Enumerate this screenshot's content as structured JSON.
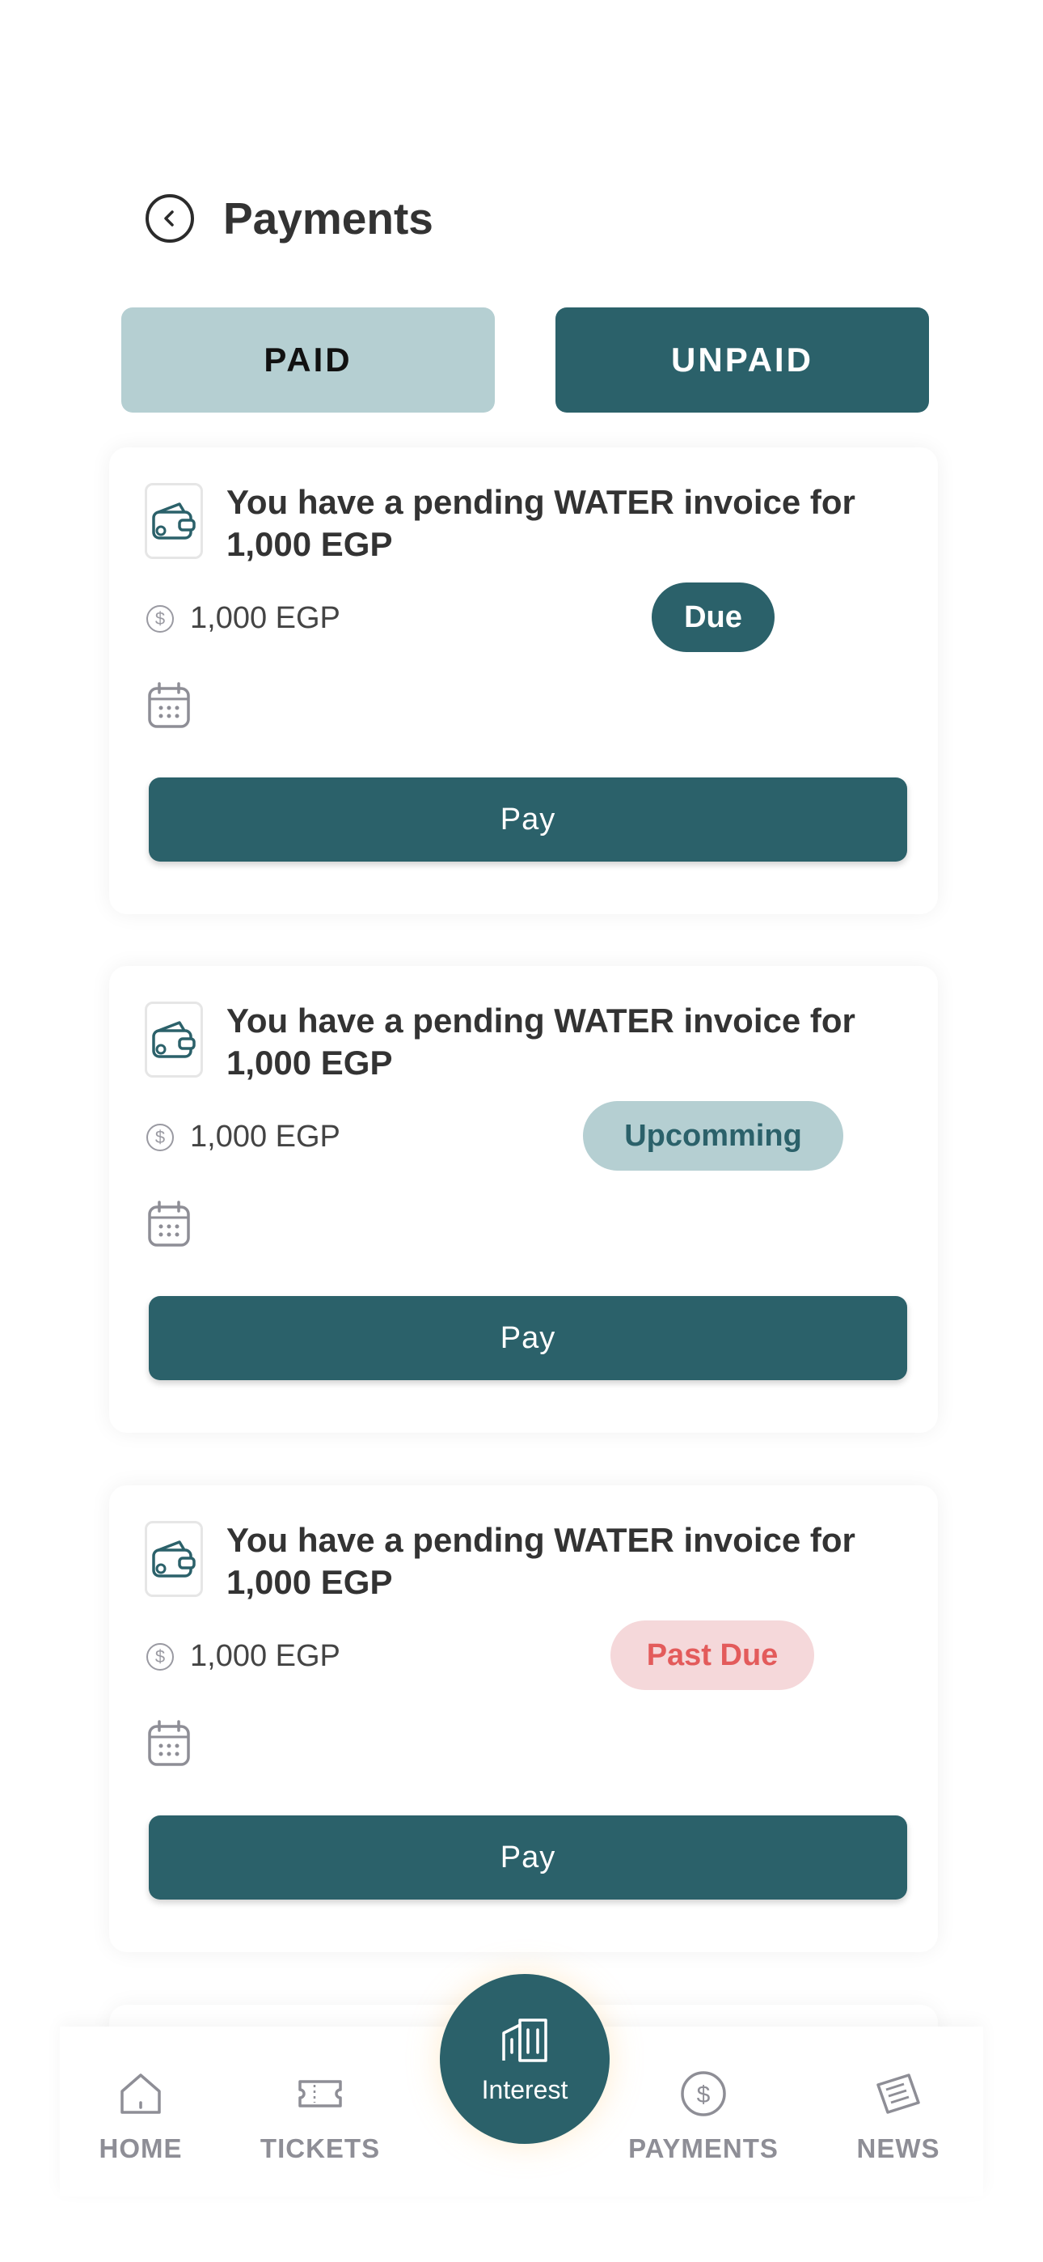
{
  "header": {
    "title": "Payments"
  },
  "tabs": {
    "paid": "PAID",
    "unpaid": "UNPAID"
  },
  "cards": [
    {
      "title": "You have a pending WATER invoice for 1,000 EGP",
      "amount": "1,000 EGP",
      "status": "Due",
      "pay_label": "Pay"
    },
    {
      "title": "You have a pending WATER invoice for 1,000 EGP",
      "amount": "1,000 EGP",
      "status": "Upcomming",
      "pay_label": "Pay"
    },
    {
      "title": "You have a pending WATER invoice for 1,000 EGP",
      "amount": "1,000 EGP",
      "status": "Past Due",
      "pay_label": "Pay"
    }
  ],
  "status_colors": {
    "due": "#2b616a",
    "upcoming": "#b5cfd2",
    "past_due": "#e35b5b"
  },
  "accent": "#2b616a",
  "bottom_nav": {
    "home": "HOME",
    "tickets": "TICKETS",
    "interest": "Interest",
    "payments": "PAYMENTS",
    "news": "NEWS"
  }
}
